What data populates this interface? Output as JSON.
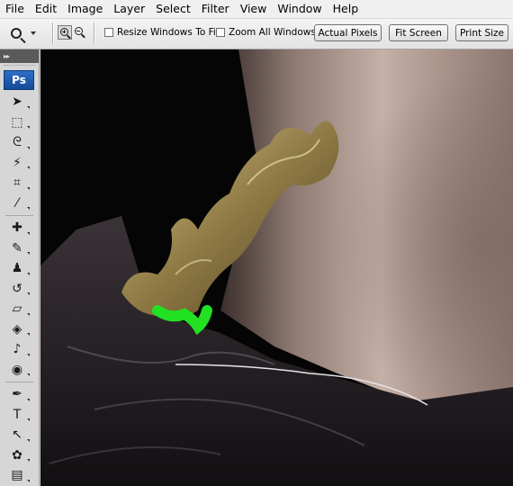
{
  "menu": {
    "items": [
      "File",
      "Edit",
      "Image",
      "Layer",
      "Select",
      "Filter",
      "View",
      "Window",
      "Help"
    ]
  },
  "options_bar": {
    "tool_icon": "zoom-icon",
    "zoom_in_icon": "zoom-in-icon",
    "zoom_out_icon": "zoom-out-icon",
    "resize_windows_label": "Resize Windows To Fit",
    "resize_windows_checked": false,
    "zoom_all_windows_label": "Zoom All Windows",
    "zoom_all_windows_checked": false,
    "actual_pixels_label": "Actual Pixels",
    "fit_screen_label": "Fit Screen",
    "print_size_label": "Print Size"
  },
  "tools_panel": {
    "collapse_glyph": "▸▸",
    "logo": "Ps",
    "tools": [
      {
        "name": "move-tool",
        "glyph": "➤"
      },
      {
        "name": "marquee-tool",
        "glyph": "⬚"
      },
      {
        "name": "lasso-tool",
        "glyph": "ᘓ"
      },
      {
        "name": "magic-wand-tool",
        "glyph": "⚡"
      },
      {
        "name": "crop-tool",
        "glyph": "⌗"
      },
      {
        "name": "eyedropper-tool",
        "glyph": "⁄"
      },
      {
        "name": "healing-brush-tool",
        "glyph": "✚"
      },
      {
        "name": "brush-tool",
        "glyph": "✎"
      },
      {
        "name": "clone-stamp-tool",
        "glyph": "♟"
      },
      {
        "name": "history-brush-tool",
        "glyph": "↺"
      },
      {
        "name": "eraser-tool",
        "glyph": "▱"
      },
      {
        "name": "paint-bucket-tool",
        "glyph": "◈"
      },
      {
        "name": "dodge-tool",
        "glyph": "♪"
      },
      {
        "name": "sponge-tool",
        "glyph": "◉"
      },
      {
        "name": "pen-tool",
        "glyph": "✒"
      },
      {
        "name": "type-tool",
        "glyph": "T"
      },
      {
        "name": "path-selection-tool",
        "glyph": "↖"
      },
      {
        "name": "custom-shape-tool",
        "glyph": "✿"
      },
      {
        "name": "notes-tool",
        "glyph": "▤"
      }
    ]
  },
  "colors": {
    "highlight_green": "#22e022",
    "ornament_gold": "#b8a46a",
    "skin": "#b49e93",
    "background": "#050505"
  }
}
